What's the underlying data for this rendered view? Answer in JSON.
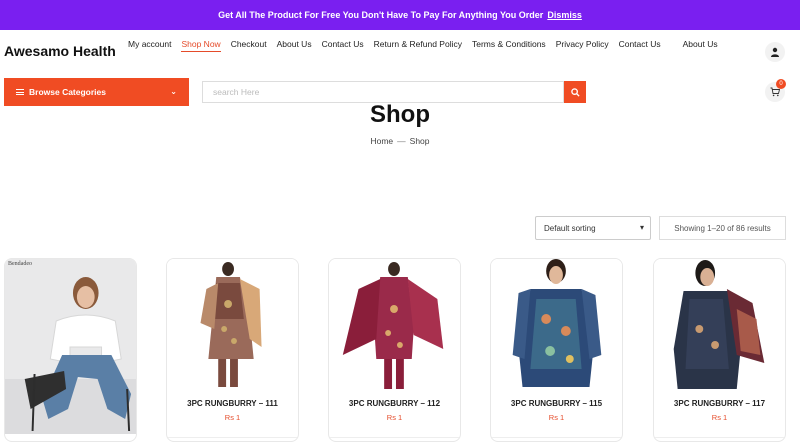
{
  "banner": {
    "message": "Get All The Product For Free You Don't Have To Pay For Anything You Order",
    "dismiss_label": "Dismiss"
  },
  "header": {
    "logo": "Awesamo Health",
    "nav": [
      {
        "label": "My account",
        "active": false
      },
      {
        "label": "Shop Now",
        "active": true
      },
      {
        "label": "Checkout",
        "active": false
      },
      {
        "label": "About Us",
        "active": false
      },
      {
        "label": "Contact Us",
        "active": false
      },
      {
        "label": "Return & Refund Policy",
        "active": false
      },
      {
        "label": "Terms & Conditions",
        "active": false
      },
      {
        "label": "Privacy Policy",
        "active": false
      },
      {
        "label": "Contact Us",
        "active": false
      },
      {
        "label": "About Us",
        "active": false
      }
    ]
  },
  "toolbar": {
    "browse_label": "Browse Categories",
    "search_placeholder": "search Here",
    "cart_count": "0"
  },
  "hero": {
    "title": "Shop",
    "breadcrumb": [
      "Home",
      "Shop"
    ],
    "breadcrumb_sep": "—"
  },
  "listing": {
    "sorting_selected": "Default sorting",
    "results_text": "Showing 1–20 of 86 results"
  },
  "products": [
    {
      "name": "",
      "price": "",
      "ad_label": "Bendadeo"
    },
    {
      "name": "3PC RUNGBURRY – 111",
      "price": "Rs 1"
    },
    {
      "name": "3PC RUNGBURRY – 112",
      "price": "Rs 1"
    },
    {
      "name": "3PC RUNGBURRY – 115",
      "price": "Rs 1"
    },
    {
      "name": "3PC RUNGBURRY – 117",
      "price": "Rs 1"
    }
  ],
  "colors": {
    "banner": "#7a1ff0",
    "accent": "#f04c23",
    "price": "#e54b2a"
  }
}
